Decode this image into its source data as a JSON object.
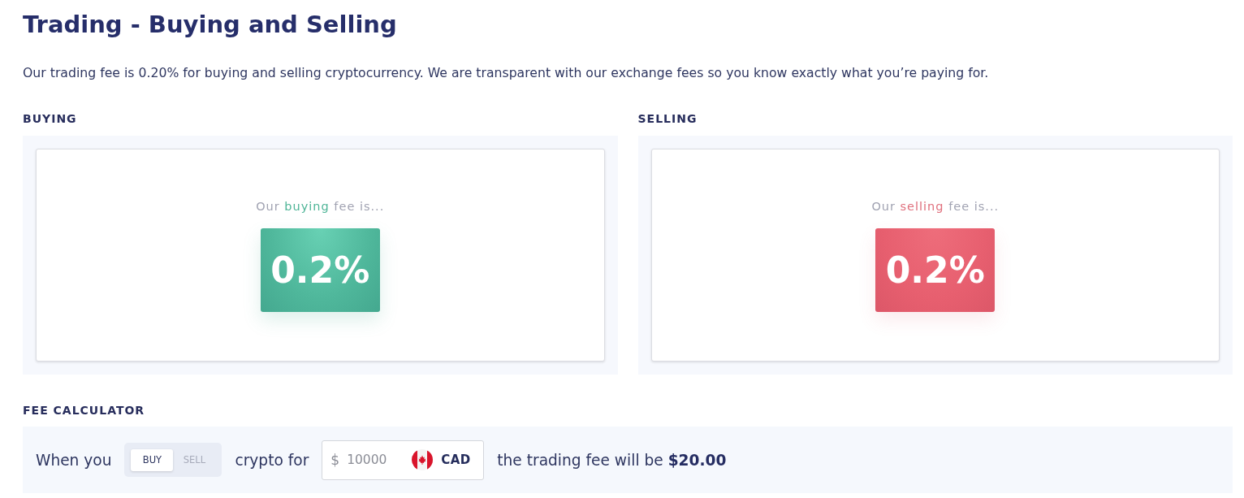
{
  "title": "Trading - Buying and Selling",
  "intro": "Our trading fee is 0.20% for buying and selling cryptocurrency. We are transparent with our exchange fees so you know exactly what you’re paying for.",
  "fee_sections": [
    {
      "kind": "buy",
      "heading": "BUYING",
      "caption_start": "Our",
      "caption_highlight": "buying",
      "caption_end": "fee is...",
      "fee": "0.2%"
    },
    {
      "kind": "sell",
      "heading": "SELLING",
      "caption_start": "Our",
      "caption_highlight": "selling",
      "caption_end": "fee is...",
      "fee": "0.2%"
    }
  ],
  "fee_calculator": {
    "heading": "FEE CALCULATOR",
    "lead": "When you",
    "sides": [
      {
        "label": "BUY",
        "selected": true
      },
      {
        "label": "SELL",
        "selected": false
      }
    ],
    "connector": "crypto for",
    "amount": {
      "symbol": "$",
      "value": "10000",
      "currency": "CAD"
    },
    "result": "the trading fee will be **$20.00**"
  }
}
